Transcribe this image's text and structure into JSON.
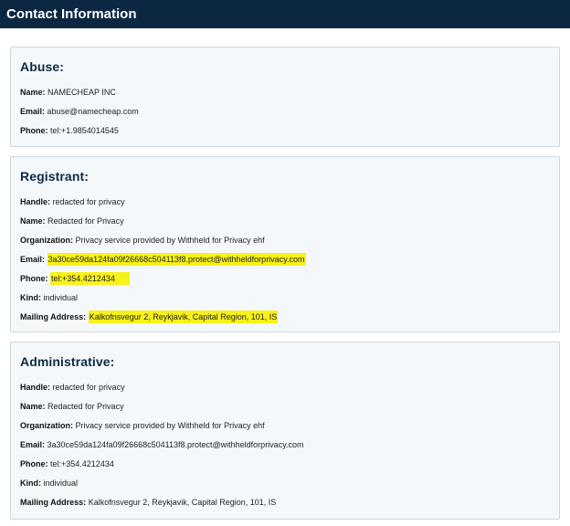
{
  "header": {
    "title": "Contact Information"
  },
  "abuse": {
    "title": "Abuse:",
    "fields": [
      {
        "label": "Name:",
        "value": "NAMECHEAP INC"
      },
      {
        "label": "Email:",
        "value": "abuse@namecheap.com"
      },
      {
        "label": "Phone:",
        "value": "tel:+1.9854014545"
      }
    ]
  },
  "registrant": {
    "title": "Registrant:",
    "fields": [
      {
        "label": "Handle:",
        "value": "redacted for privacy"
      },
      {
        "label": "Name:",
        "value": "Redacted for Privacy"
      },
      {
        "label": "Organization:",
        "value": "Privacy service provided by Withheld for Privacy ehf"
      },
      {
        "label": "Email:",
        "value": "3a30ce59da124fa09f26668c504113f8.protect@withheldforprivacy.com"
      },
      {
        "label": "Phone:",
        "value": "tel:+354.4212434"
      },
      {
        "label": "Kind:",
        "value": "individual"
      },
      {
        "label": "Mailing Address:",
        "value": "Kalkofnsvegur 2, Reykjavik, Capital Region, 101, IS"
      }
    ]
  },
  "administrative": {
    "title": "Administrative:",
    "fields": [
      {
        "label": "Handle:",
        "value": "redacted for privacy"
      },
      {
        "label": "Name:",
        "value": "Redacted for Privacy"
      },
      {
        "label": "Organization:",
        "value": "Privacy service provided by Withheld for Privacy ehf"
      },
      {
        "label": "Email:",
        "value": "3a30ce59da124fa09f26668c504113f8.protect@withheldforprivacy.com"
      },
      {
        "label": "Phone:",
        "value": "tel:+354.4212434"
      },
      {
        "label": "Kind:",
        "value": "individual"
      },
      {
        "label": "Mailing Address:",
        "value": "Kalkofnsvegur 2, Reykjavik, Capital Region, 101, IS"
      }
    ]
  },
  "colors": {
    "header_bg": "#0b2742",
    "card_bg": "#f4f8fb",
    "highlight": "#f7f21a",
    "title_text": "#0e2942"
  }
}
